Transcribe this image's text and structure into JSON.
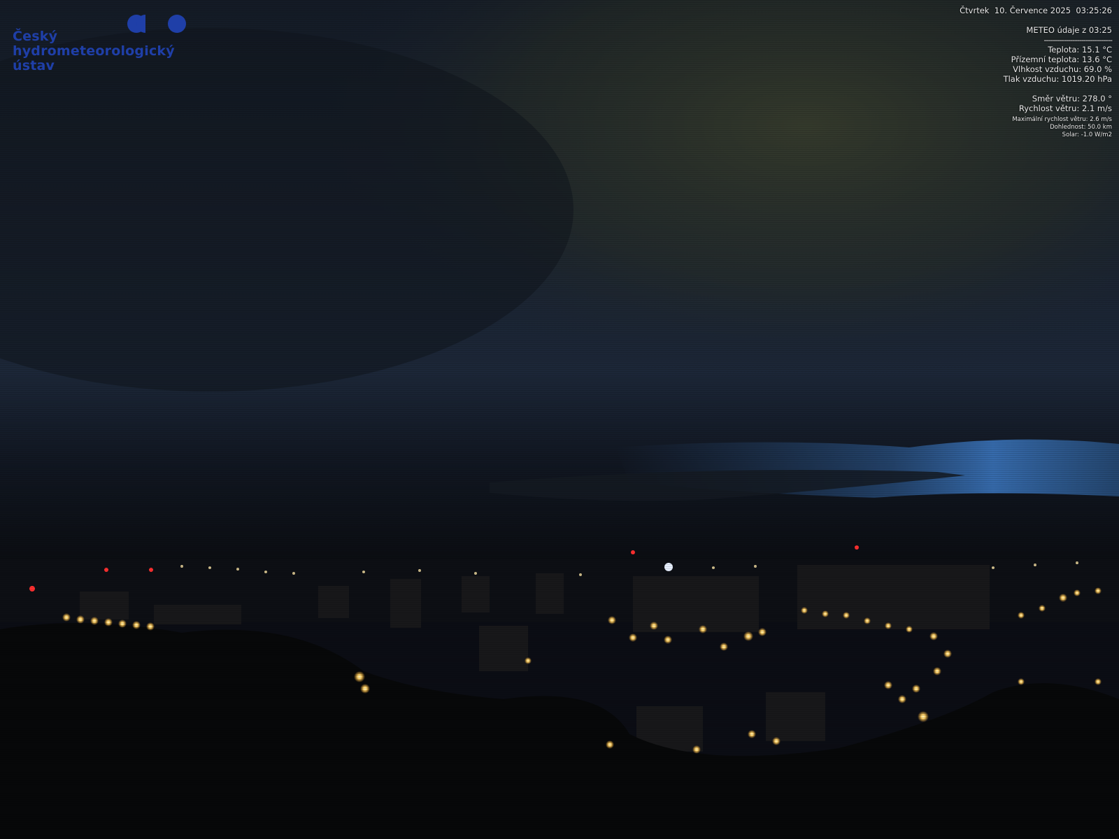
{
  "logo": {
    "lines": [
      "Český",
      "hydrometeorologický",
      "ústav"
    ],
    "color": "#1f3fa8"
  },
  "overlay": {
    "datetime": "Čtvrtek  10. Července 2025  03:25:26",
    "meteo_header": "METEO údaje z 03:25",
    "separator": "-------------------------------",
    "temperature": "Teplota: 15.1 °C",
    "ground_temperature": "Přízemní teplota: 13.6 °C",
    "humidity": "Vlhkost vzduchu: 69.0 %",
    "pressure": "Tlak vzduchu: 1019.20 hPa",
    "wind_direction": "Směr větru: 278.0 °",
    "wind_speed": "Rychlost větru: 2.1 m/s",
    "max_wind_speed": "Maximální rychlost větru: 2.6 m/s",
    "visibility": "Dohlednost: 50.0 km",
    "solar": "Solar: -1.0 W/m2"
  },
  "scene": {
    "sky_color": "#16202e",
    "cloud_color": "#2b3326",
    "horizon_glow": "#3a6aa8",
    "light_color": "#ffd36a",
    "ground_color": "#07080a"
  }
}
